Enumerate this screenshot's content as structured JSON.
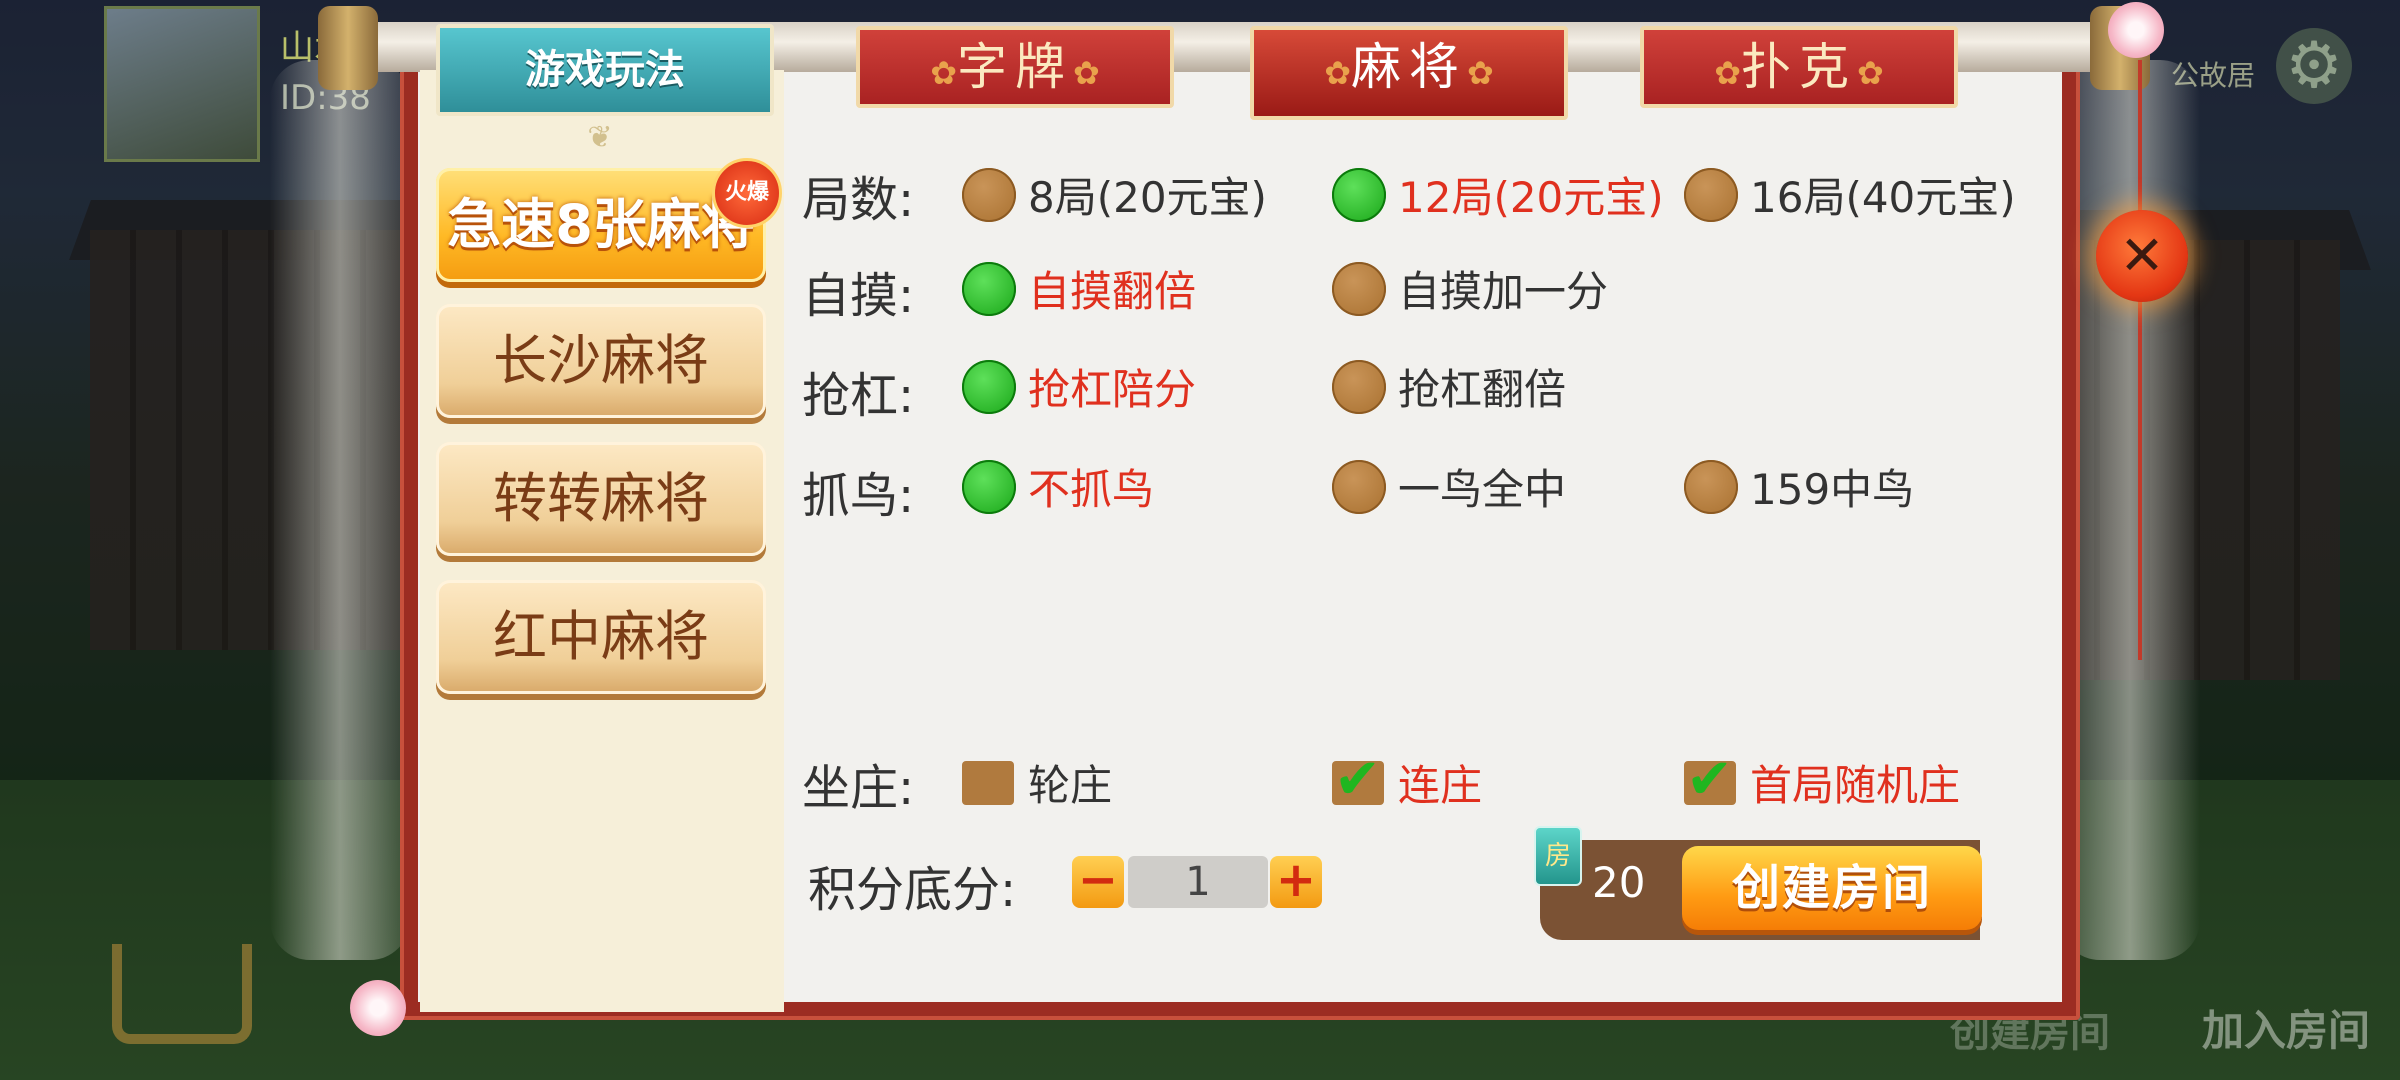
{
  "lobby": {
    "player_name": "山水",
    "player_id": "ID:38",
    "place": "公故居",
    "bottom_join": "加入房间",
    "bottom_create": "创建房间"
  },
  "sidebar": {
    "header": "游戏玩法",
    "hot_badge": "火爆",
    "games": [
      "急速8张麻将",
      "长沙麻将",
      "转转麻将",
      "红中麻将"
    ]
  },
  "tabs": {
    "zipai": "字牌",
    "majiang": "麻将",
    "puke": "扑克"
  },
  "rows": {
    "rounds": {
      "label": "局数:",
      "options": [
        "8局(20元宝)",
        "12局(20元宝)",
        "16局(40元宝)"
      ],
      "selected": 1
    },
    "zimo": {
      "label": "自摸:",
      "options": [
        "自摸翻倍",
        "自摸加一分"
      ],
      "selected": 0
    },
    "qianggang": {
      "label": "抢杠:",
      "options": [
        "抢杠陪分",
        "抢杠翻倍"
      ],
      "selected": 0
    },
    "zhuaniao": {
      "label": "抓鸟:",
      "options": [
        "不抓鸟",
        "一鸟全中",
        "159中鸟"
      ],
      "selected": 0
    },
    "zuozhuang": {
      "label": "坐庄:",
      "options": [
        "轮庄",
        "连庄",
        "首局随机庄"
      ],
      "checked": [
        false,
        true,
        true
      ]
    }
  },
  "score": {
    "label": "积分底分:",
    "minus": "−",
    "plus": "+",
    "value": "1"
  },
  "create": {
    "room_card_icon": "房",
    "cost": "20",
    "button": "创建房间"
  },
  "close_icon": "✕",
  "colors": {
    "selected_text": "#e0301e",
    "accent_orange": "#ff9b13",
    "frame_red": "#9c2c22"
  }
}
